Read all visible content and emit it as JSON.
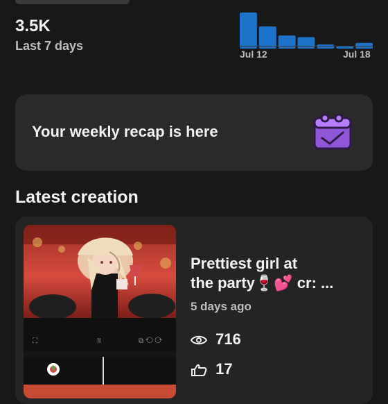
{
  "summary": {
    "value": "3.5K",
    "period": "Last 7 days"
  },
  "mini_chart": {
    "start_label": "Jul 12",
    "end_label": "Jul 18",
    "values": [
      44,
      27,
      16,
      14,
      5,
      3,
      7
    ],
    "bar_color": "#1c73c9"
  },
  "recap": {
    "text": "Your weekly recap is here",
    "icon": "calendar-check-icon",
    "icon_color": "#b77dff"
  },
  "latest": {
    "section_title": "Latest creation",
    "title_line1": "Prettiest girl at",
    "title_line2": "the party🍷💕 cr: ...",
    "age": "5 days ago",
    "views": "716",
    "likes": "17"
  }
}
